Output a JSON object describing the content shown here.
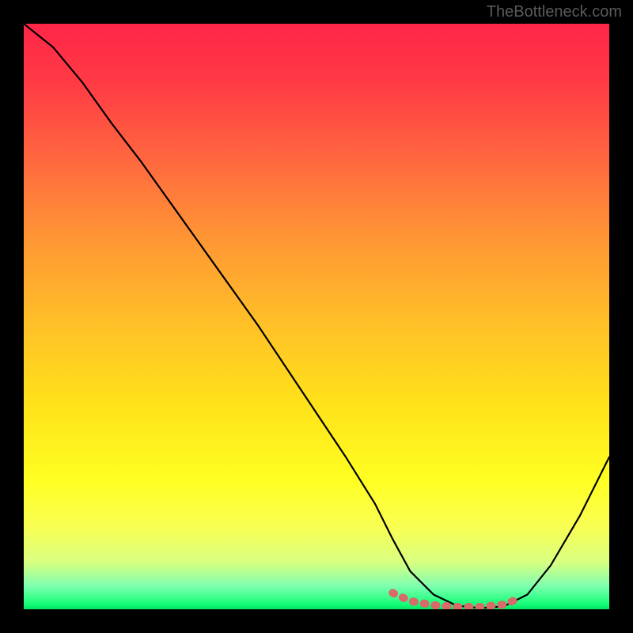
{
  "watermark": "TheBottleneck.com",
  "chart_data": {
    "type": "line",
    "title": "",
    "xlabel": "",
    "ylabel": "",
    "xlim": [
      0,
      100
    ],
    "ylim": [
      0,
      100
    ],
    "grid": false,
    "legend": false,
    "series": [
      {
        "name": "curve",
        "color": "#000000",
        "x": [
          0,
          5,
          10,
          15,
          20,
          25,
          30,
          35,
          40,
          45,
          50,
          55,
          60,
          63,
          66,
          70,
          74,
          78,
          82,
          86,
          90,
          95,
          100
        ],
        "y": [
          100,
          96,
          90,
          83,
          76.5,
          69.5,
          62.5,
          55.5,
          48.5,
          41,
          33.5,
          26,
          18,
          12,
          6.5,
          2.5,
          0.6,
          0.2,
          0.5,
          2.5,
          7.5,
          16,
          26
        ]
      },
      {
        "name": "highlight",
        "color": "#e06666",
        "x": [
          63,
          66,
          70,
          74,
          78,
          82,
          85
        ],
        "y": [
          2.8,
          1.4,
          0.7,
          0.4,
          0.4,
          0.8,
          2.0
        ]
      }
    ],
    "gradient_stops": [
      {
        "pos": 0,
        "color": "#ff2648"
      },
      {
        "pos": 25,
        "color": "#ff6e3e"
      },
      {
        "pos": 50,
        "color": "#ffc227"
      },
      {
        "pos": 78,
        "color": "#ffff22"
      },
      {
        "pos": 96,
        "color": "#7fffb0"
      },
      {
        "pos": 100,
        "color": "#00e765"
      }
    ]
  }
}
